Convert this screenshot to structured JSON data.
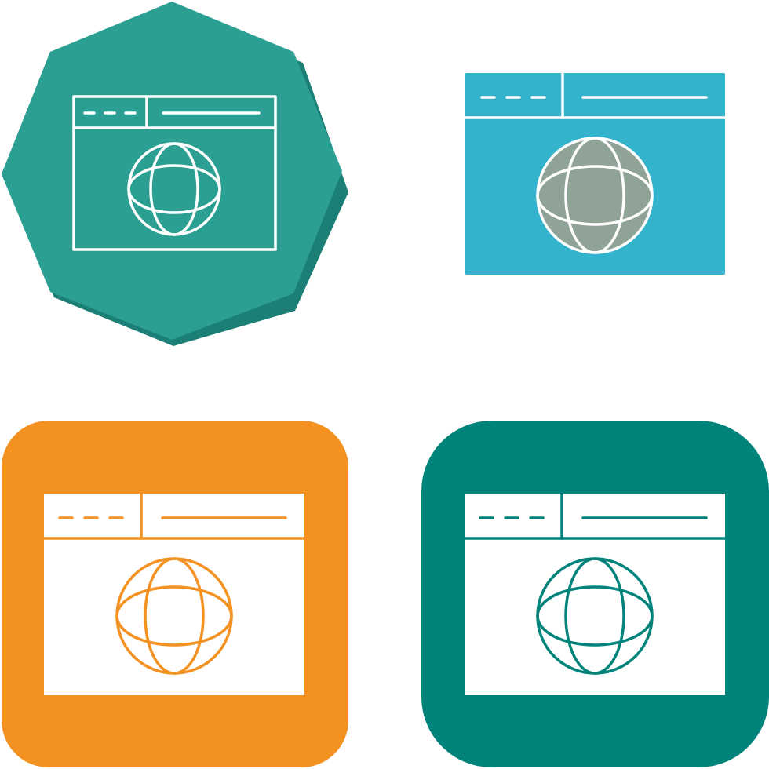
{
  "icon_set": {
    "subject": "browser-globe-icon",
    "variants": [
      {
        "name": "octagon-outline",
        "style": "line icon on octagon badge",
        "colors": {
          "badge": "#2a9f92",
          "badge_shadow": "#1b7f76",
          "stroke": "#ffffff"
        }
      },
      {
        "name": "flat-color",
        "style": "flat filled icon",
        "colors": {
          "window": "#33b3cc",
          "globe": "#8fa396",
          "stroke": "#ffffff"
        }
      },
      {
        "name": "orange-rounded-square",
        "style": "glyph on rounded square",
        "colors": {
          "badge": "#f39121",
          "window": "#ffffff",
          "stroke": "#f39121"
        }
      },
      {
        "name": "teal-rounded-square",
        "style": "glyph on rounded square",
        "colors": {
          "badge": "#00837a",
          "window": "#ffffff",
          "stroke": "#00837a"
        }
      }
    ]
  }
}
